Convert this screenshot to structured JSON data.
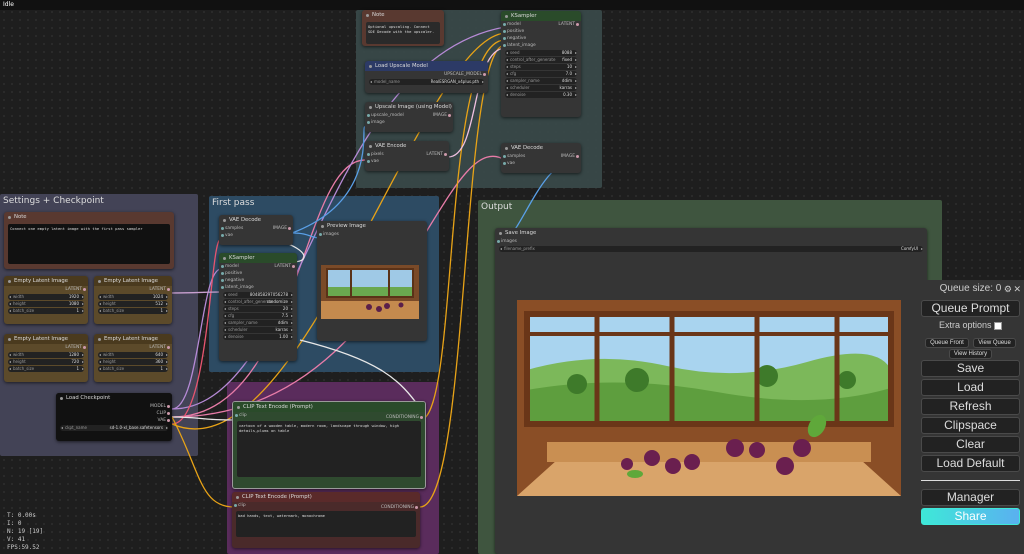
{
  "window": {
    "status": "Idle"
  },
  "groups": {
    "settings": "Settings + Checkpoint",
    "first_pass": "First pass",
    "output": "Output"
  },
  "nodes": {
    "note_top": {
      "title": "Note",
      "text": "Optional upscaling. Connect SDE Decode with the upscaler."
    },
    "ksampler_top": {
      "title": "KSampler",
      "inputs": [
        "model",
        "positive",
        "negative",
        "latent_image"
      ],
      "output": "LATENT",
      "widgets": [
        [
          "seed",
          "8088"
        ],
        [
          "control_after_generate",
          "fixed"
        ],
        [
          "steps",
          "10"
        ],
        [
          "cfg",
          "7.0"
        ],
        [
          "sampler_name",
          "ddim"
        ],
        [
          "scheduler",
          "karras"
        ],
        [
          "denoise",
          "0.30"
        ]
      ]
    },
    "load_upscale": {
      "title": "Load Upscale Model",
      "output": "UPSCALE_MODEL",
      "widget": [
        "model_name",
        "RealESRGAN_x4plus.pth"
      ]
    },
    "upscale_image": {
      "title": "Upscale Image (using Model)",
      "inputs": [
        "upscale_model",
        "image"
      ],
      "output": "IMAGE"
    },
    "vae_encode": {
      "title": "VAE Encode",
      "inputs": [
        "pixels",
        "vae"
      ],
      "output": "LATENT"
    },
    "vae_decode_top": {
      "title": "VAE Decode",
      "inputs": [
        "samples",
        "vae"
      ],
      "output": "IMAGE"
    },
    "note_left": {
      "title": "Note",
      "text": "Connect one empty latent image with the first pass sampler"
    },
    "latent1": {
      "title": "Empty Latent Image",
      "output": "LATENT",
      "widgets": [
        [
          "width",
          "1920"
        ],
        [
          "height",
          "1080"
        ],
        [
          "batch_size",
          "1"
        ]
      ]
    },
    "latent2": {
      "title": "Empty Latent Image",
      "output": "LATENT",
      "widgets": [
        [
          "width",
          "1024"
        ],
        [
          "height",
          "512"
        ],
        [
          "batch_size",
          "1"
        ]
      ]
    },
    "latent3": {
      "title": "Empty Latent Image",
      "output": "LATENT",
      "widgets": [
        [
          "width",
          "1280"
        ],
        [
          "height",
          "720"
        ],
        [
          "batch_size",
          "1"
        ]
      ]
    },
    "latent4": {
      "title": "Empty Latent Image",
      "output": "LATENT",
      "widgets": [
        [
          "width",
          "640"
        ],
        [
          "height",
          "360"
        ],
        [
          "batch_size",
          "1"
        ]
      ]
    },
    "load_checkpoint": {
      "title": "Load Checkpoint",
      "outputs": [
        "MODEL",
        "CLIP",
        "VAE"
      ],
      "widget": [
        "ckpt_name",
        "sd-1.0-xl_base.safetensors"
      ]
    },
    "vae_decode_mid": {
      "title": "VAE Decode",
      "inputs": [
        "samples",
        "vae"
      ],
      "output": "IMAGE"
    },
    "preview_image": {
      "title": "Preview Image",
      "input": "images"
    },
    "ksampler_mid": {
      "title": "KSampler",
      "inputs": [
        "model",
        "positive",
        "negative",
        "latent_image"
      ],
      "output": "LATENT",
      "widgets": [
        [
          "seed",
          "804858297056278"
        ],
        [
          "control_after_generate",
          "randomize"
        ],
        [
          "steps",
          "20"
        ],
        [
          "cfg",
          "7.5"
        ],
        [
          "sampler_name",
          "ddim"
        ],
        [
          "scheduler",
          "karras"
        ],
        [
          "denoise",
          "1.00"
        ]
      ]
    },
    "clip_pos": {
      "title": "CLIP Text Encode (Prompt)",
      "input": "clip",
      "output": "CONDITIONING",
      "text": "cartoon of a wooden table, modern room, landscape through window, high details,plums on table"
    },
    "clip_neg": {
      "title": "CLIP Text Encode (Prompt)",
      "input": "clip",
      "output": "CONDITIONING",
      "text": "bad hands, text, watermark, monochrome"
    },
    "save_image": {
      "title": "Save Image",
      "input": "images",
      "widget": [
        "filename_prefix",
        "ComfyUI"
      ]
    }
  },
  "panel": {
    "queue_size": "Queue size: 0",
    "queue_prompt": "Queue Prompt",
    "extra_options": "Extra options",
    "queue_front": "Queue Front",
    "view_queue": "View Queue",
    "view_history": "View History",
    "save": "Save",
    "load": "Load",
    "refresh": "Refresh",
    "clipspace": "Clipspace",
    "clear": "Clear",
    "load_default": "Load Default",
    "manager": "Manager",
    "share": "Share"
  },
  "stats": {
    "t": "T: 0.00s",
    "i": "I: 0",
    "n": "N: 19 [19]",
    "v": "V: 41",
    "fps": "FPS:59.52"
  },
  "colors": {
    "accent_share": "#3ee8d8",
    "wire_yellow": "#e8a317",
    "wire_pink": "#e87ca8",
    "wire_blue": "#5aa0e8"
  }
}
